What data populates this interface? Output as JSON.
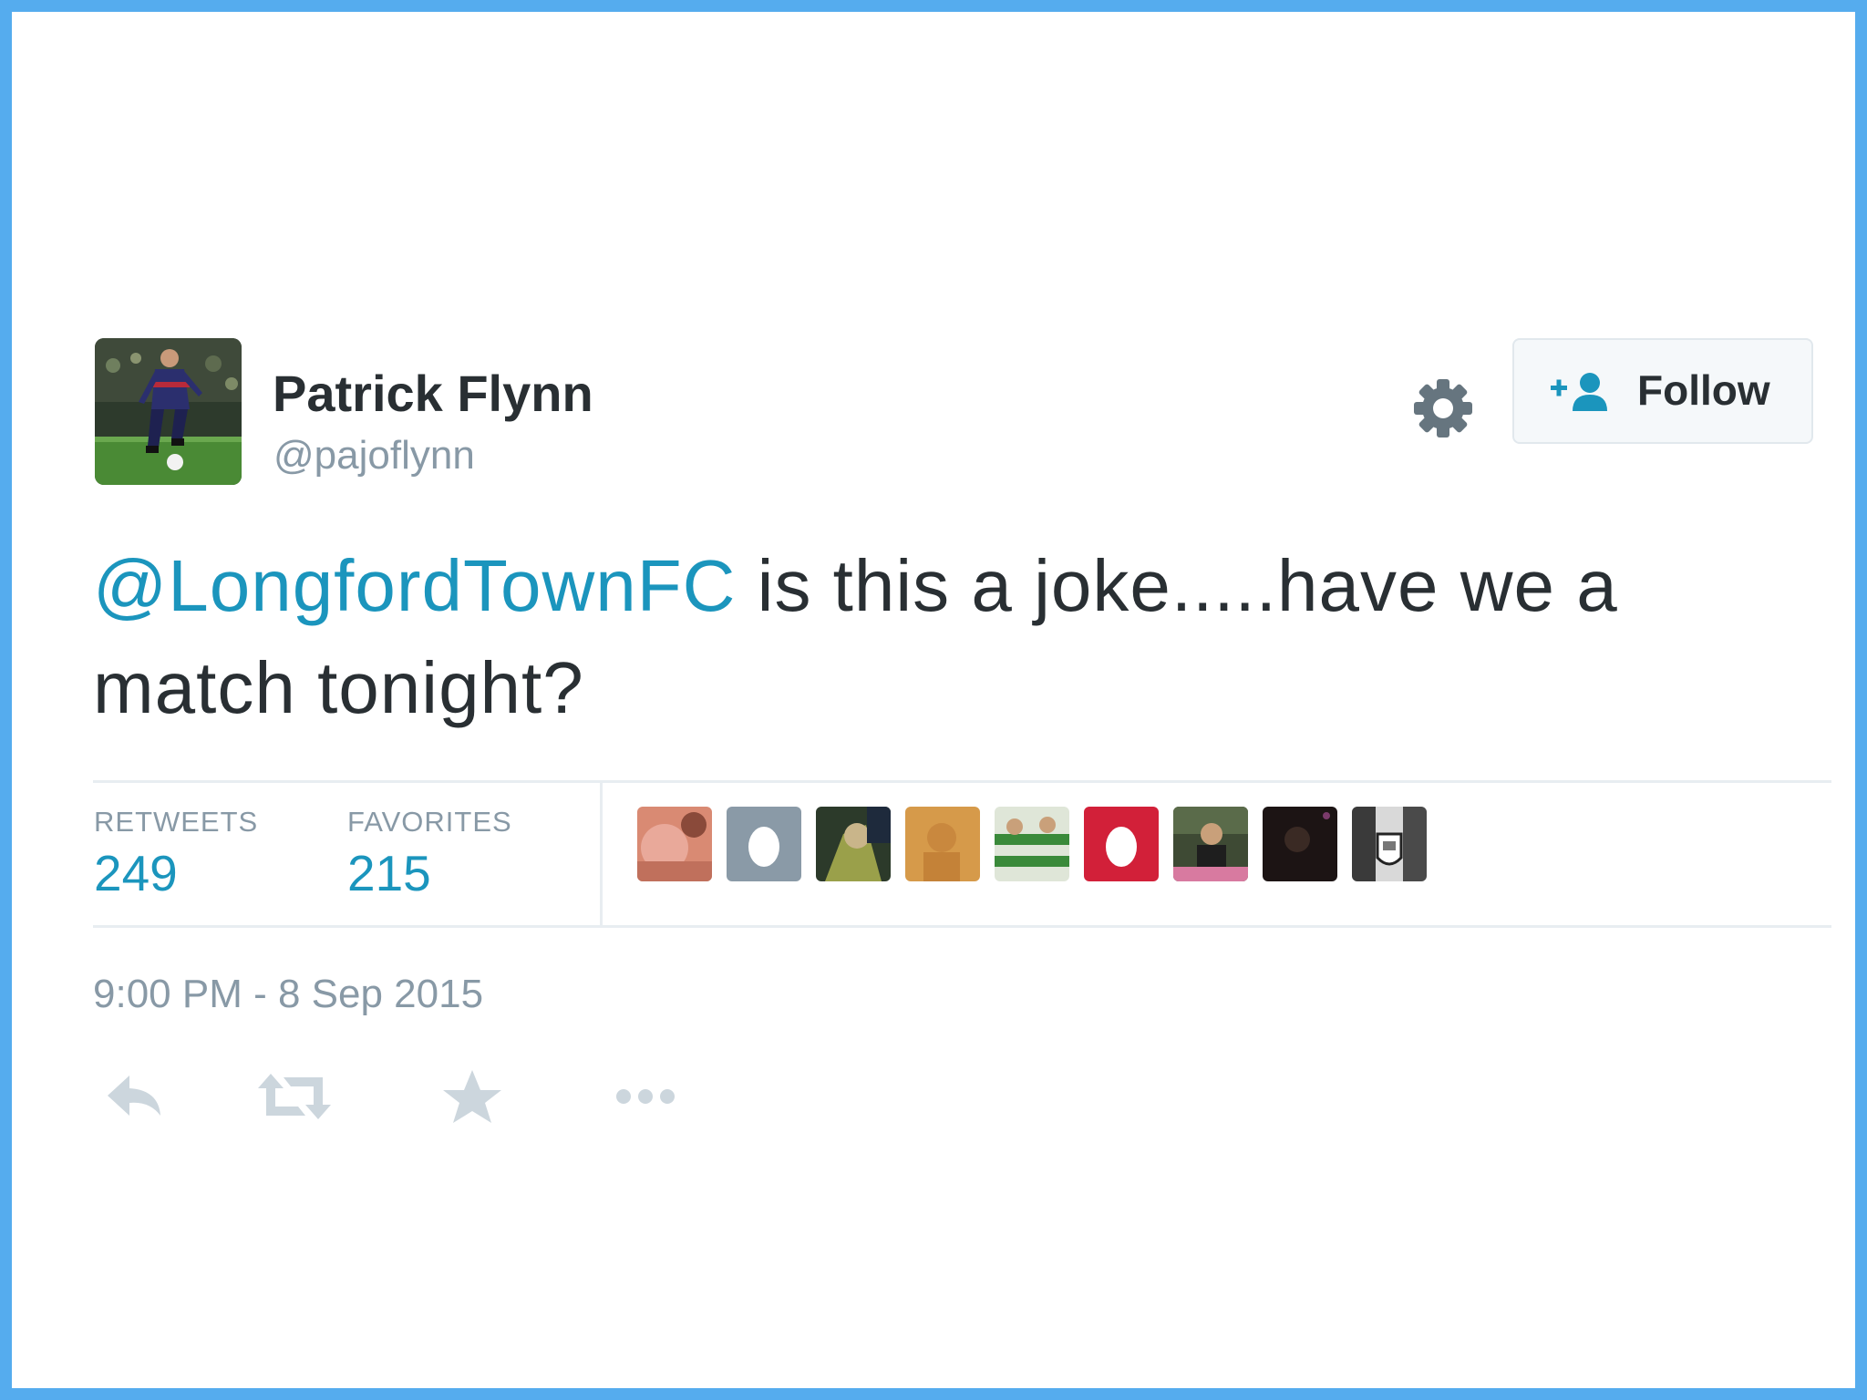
{
  "user": {
    "name": "Patrick Flynn",
    "handle": "@pajoflynn"
  },
  "follow_button": {
    "label": "Follow"
  },
  "tweet": {
    "mention": "@LongfordTownFC",
    "text": " is this a joke.....have we a match tonight?"
  },
  "stats": {
    "retweets_label": "RETWEETS",
    "retweets_count": "249",
    "favorites_label": "FAVORITES",
    "favorites_count": "215"
  },
  "timestamp": "9:00 PM - 8 Sep 2015",
  "actions": [
    "reply-icon",
    "retweet-icon",
    "favorite-icon",
    "more-icon"
  ],
  "colors": {
    "frame": "#55acee",
    "link": "#1b95bd",
    "text": "#292f33",
    "muted": "#8899a6",
    "action_icon": "#ccd6dd"
  }
}
